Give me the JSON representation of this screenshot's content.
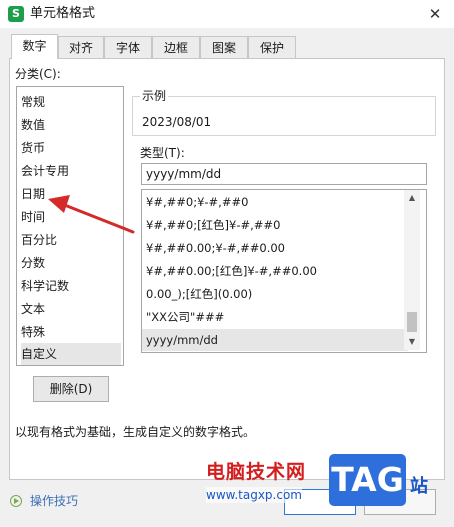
{
  "window": {
    "title": "单元格格式",
    "app_icon_letter": "S",
    "close_glyph": "✕"
  },
  "tabs": [
    {
      "label": "数字",
      "active": true
    },
    {
      "label": "对齐"
    },
    {
      "label": "字体"
    },
    {
      "label": "边框"
    },
    {
      "label": "图案"
    },
    {
      "label": "保护"
    }
  ],
  "category": {
    "label": "分类(C):",
    "items": [
      "常规",
      "数值",
      "货币",
      "会计专用",
      "日期",
      "时间",
      "百分比",
      "分数",
      "科学记数",
      "文本",
      "特殊",
      "自定义"
    ],
    "selected": "自定义"
  },
  "sample": {
    "label": "示例",
    "value": "2023/08/01"
  },
  "type": {
    "label": "类型(T):",
    "value": "yyyy/mm/dd",
    "formats": [
      "¥#,##0;¥-#,##0",
      "¥#,##0;[红色]¥-#,##0",
      "¥#,##0.00;¥-#,##0.00",
      "¥#,##0.00;[红色]¥-#,##0.00",
      "0.00_);[红色](0.00)",
      "\"XX公司\"###",
      "yyyy/mm/dd"
    ],
    "selected": "yyyy/mm/dd"
  },
  "buttons": {
    "delete": "删除(D)"
  },
  "description": "以现有格式为基础，生成自定义的数字格式。",
  "footer": {
    "tips": "操作技巧"
  },
  "watermark": {
    "title": "电脑技术网",
    "url": "www.tagxp.com",
    "tag": "TAG",
    "site": "站"
  },
  "colors": {
    "accent": "#2f76d6",
    "arrow": "#d42a2a",
    "selected_bg": "#e6e6e6"
  }
}
